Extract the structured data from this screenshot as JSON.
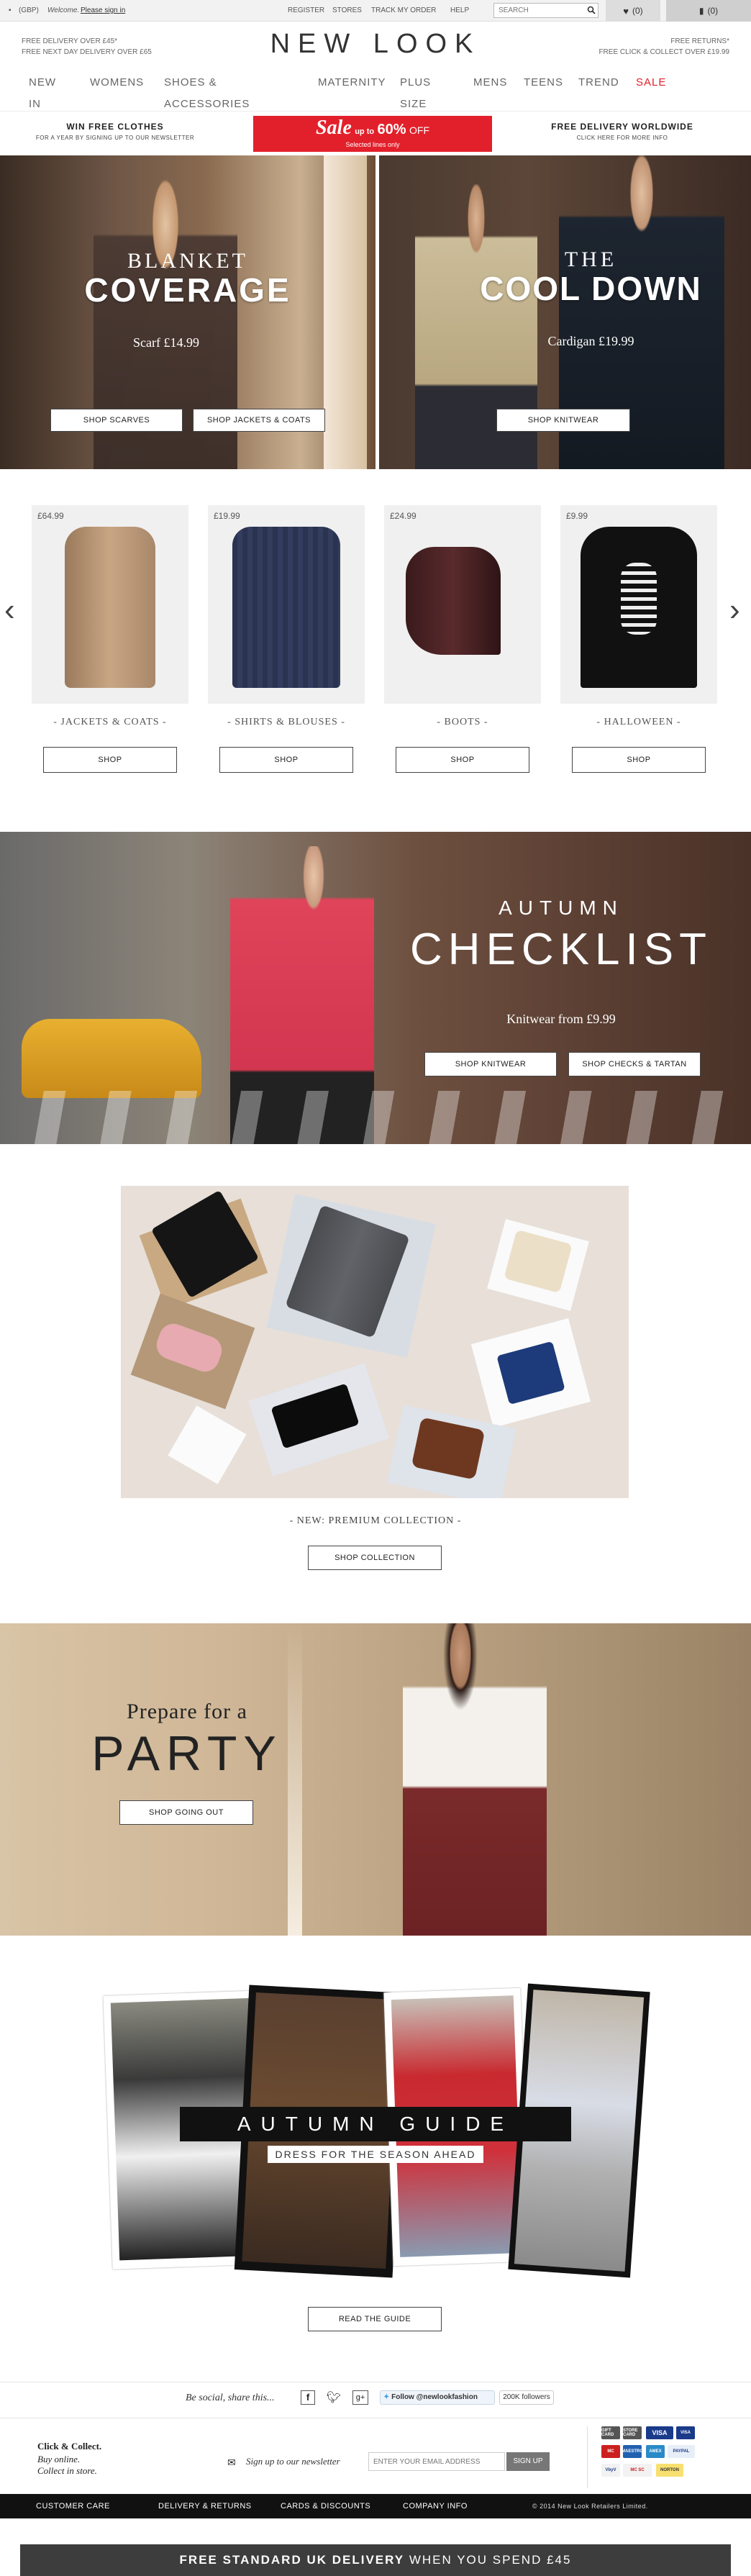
{
  "topbar": {
    "currency": "(GBP)",
    "welcome": "Welcome.",
    "sign_in": "Please sign in",
    "links": [
      "REGISTER",
      "STORES",
      "TRACK MY ORDER",
      "HELP"
    ],
    "search_placeholder": "SEARCH",
    "wishlist_count": "(0)",
    "bag_count": "(0)"
  },
  "header": {
    "left_line1": "FREE DELIVERY OVER £45*",
    "left_line2": "FREE NEXT DAY DELIVERY OVER £65",
    "logo": "NEW LOOK",
    "right_line1": "FREE RETURNS*",
    "right_line2": "FREE CLICK & COLLECT OVER £19.99"
  },
  "nav": {
    "new": "NEW",
    "in": "IN",
    "womens": "WOMENS",
    "shoes1": "SHOES &",
    "shoes2": "ACCESSORIES",
    "maternity": "MATERNITY",
    "plus1": "PLUS",
    "plus2": "SIZE",
    "mens": "MENS",
    "teens": "TEENS",
    "trend": "TREND",
    "sale": "SALE"
  },
  "promo": {
    "left_title": "WIN FREE CLOTHES",
    "left_sub": "FOR A YEAR BY SIGNING UP TO OUR NEWSLETTER",
    "sale_word": "Sale",
    "sale_upto": "up to",
    "sale_pct": "60%",
    "sale_off": "OFF",
    "sale_sub": "Selected lines only",
    "right_title": "FREE DELIVERY WORLDWIDE",
    "right_sub": "CLICK HERE FOR MORE INFO"
  },
  "hero_left": {
    "line1": "BLANKET",
    "line2": "COVERAGE",
    "price": "Scarf £14.99",
    "btn1": "SHOP SCARVES",
    "btn2": "SHOP JACKETS & COATS"
  },
  "hero_right": {
    "line1": "THE",
    "line2": "COOL DOWN",
    "price": "Cardigan £19.99",
    "btn1": "SHOP KNITWEAR"
  },
  "products": [
    {
      "price": "£64.99",
      "category": "- JACKETS & COATS -",
      "btn": "SHOP"
    },
    {
      "price": "£19.99",
      "category": "- SHIRTS & BLOUSES -",
      "btn": "SHOP"
    },
    {
      "price": "£24.99",
      "category": "- BOOTS -",
      "btn": "SHOP"
    },
    {
      "price": "£9.99",
      "category": "- HALLOWEEN -",
      "btn": "SHOP"
    }
  ],
  "checklist": {
    "line1": "AUTUMN",
    "line2": "CHECKLIST",
    "price": "Knitwear from £9.99",
    "btn1": "SHOP KNITWEAR",
    "btn2": "SHOP CHECKS & TARTAN"
  },
  "premium": {
    "label": "- NEW: PREMIUM COLLECTION -",
    "btn": "SHOP COLLECTION"
  },
  "party": {
    "line1": "Prepare for a",
    "line2": "PARTY",
    "btn": "SHOP GOING OUT"
  },
  "guide": {
    "title": "AUTUMN GUIDE",
    "sub": "DRESS FOR THE SEASON AHEAD",
    "btn": "READ THE GUIDE"
  },
  "social": {
    "text": "Be social, share this...",
    "follow": "Follow @newlookfashion",
    "followers": "200K followers"
  },
  "newsletter": {
    "cc_title": "Click & Collect.",
    "cc_line1": "Buy online.",
    "cc_line2": "Collect in store.",
    "label": "Sign up to our newsletter",
    "placeholder": "ENTER YOUR EMAIL ADDRESS",
    "btn": "SIGN UP"
  },
  "payments": [
    "GIFT CARD",
    "STORE CARD",
    "VISA",
    "VISA",
    "MC",
    "MAESTRO",
    "AMEX",
    "DELTA",
    "PAYPAL",
    "VbyV",
    "MC SC",
    "NORTON"
  ],
  "footer": {
    "links": [
      "CUSTOMER CARE",
      "DELIVERY & RETURNS",
      "CARDS & DISCOUNTS",
      "COMPANY INFO"
    ],
    "copyright": "© 2014 New Look Retailers Limited."
  },
  "bottom_banner": {
    "bold": "FREE STANDARD UK DELIVERY",
    "rest": "WHEN YOU SPEND £45"
  }
}
